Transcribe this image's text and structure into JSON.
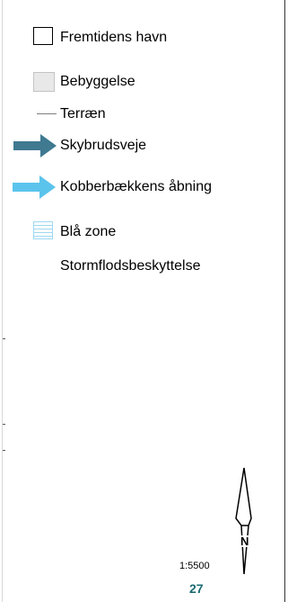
{
  "legend": {
    "items": [
      {
        "label": "Fremtidens havn",
        "symbol": "square-outline",
        "stroke": "#000000"
      },
      {
        "label": "Bebyggelse",
        "symbol": "square-filled",
        "fill": "#e8e8e8"
      },
      {
        "label": "Terræn",
        "symbol": "thin-line",
        "stroke": "#7f7f7f"
      },
      {
        "label": "Skybrudsveje",
        "symbol": "arrow-right",
        "fill": "#3f7a91"
      },
      {
        "label": "Kobberbækkens åbning",
        "symbol": "arrow-right",
        "fill": "#5bc4ec"
      },
      {
        "label": "Blå zone",
        "symbol": "striped-square",
        "stroke": "#9fd8f2"
      },
      {
        "label": "Stormflodsbeskyttelse",
        "symbol": "none"
      }
    ]
  },
  "map": {
    "scale": "1:5500",
    "north_label": "N",
    "page_number": "27",
    "page_number_color": "#1a6b73"
  }
}
